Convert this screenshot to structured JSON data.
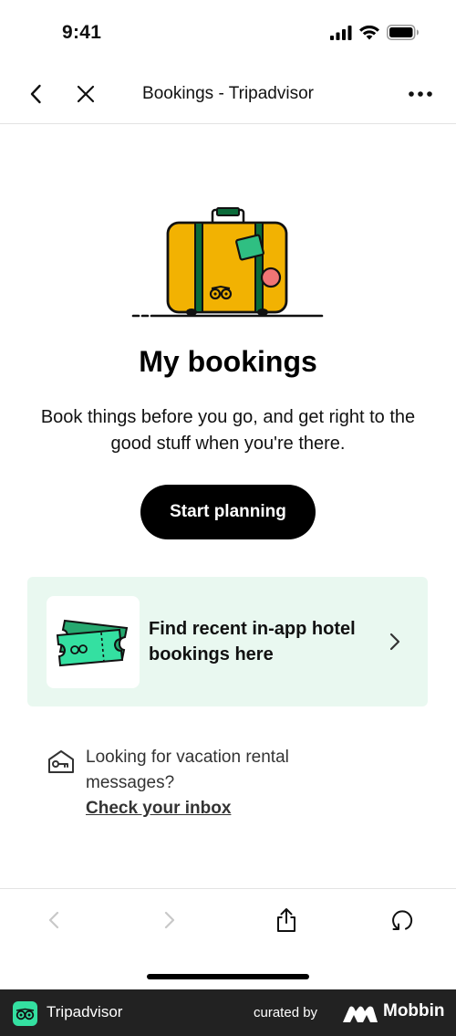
{
  "status_bar": {
    "time": "9:41"
  },
  "nav": {
    "title": "Bookings - Tripadvisor"
  },
  "empty_state": {
    "heading": "My bookings",
    "description": "Book things before you go, and get right to the good stuff when you're there.",
    "cta_label": "Start planning"
  },
  "hotel_card": {
    "text": "Find recent in-app hotel bookings here"
  },
  "rental": {
    "text": "Looking for vacation rental messages?",
    "link": "Check your inbox"
  },
  "footer": {
    "brand": "Tripadvisor",
    "curated_by": "curated by",
    "mobbin": "Mobbin"
  },
  "colors": {
    "accent_green": "#34e0a1",
    "card_bg": "#e9f8f0",
    "suitcase_yellow": "#f2b202",
    "suitcase_stripe": "#0b6b3a",
    "sticker_red": "#f07575"
  },
  "icons": [
    "signal-icon",
    "wifi-icon",
    "battery-icon",
    "back-chevron-icon",
    "close-icon",
    "more-icon",
    "ticket-icon",
    "chevron-right-icon",
    "key-house-icon",
    "browser-back-icon",
    "browser-forward-icon",
    "share-icon",
    "refresh-icon",
    "tripadvisor-owl-icon",
    "mobbin-logo-icon"
  ]
}
